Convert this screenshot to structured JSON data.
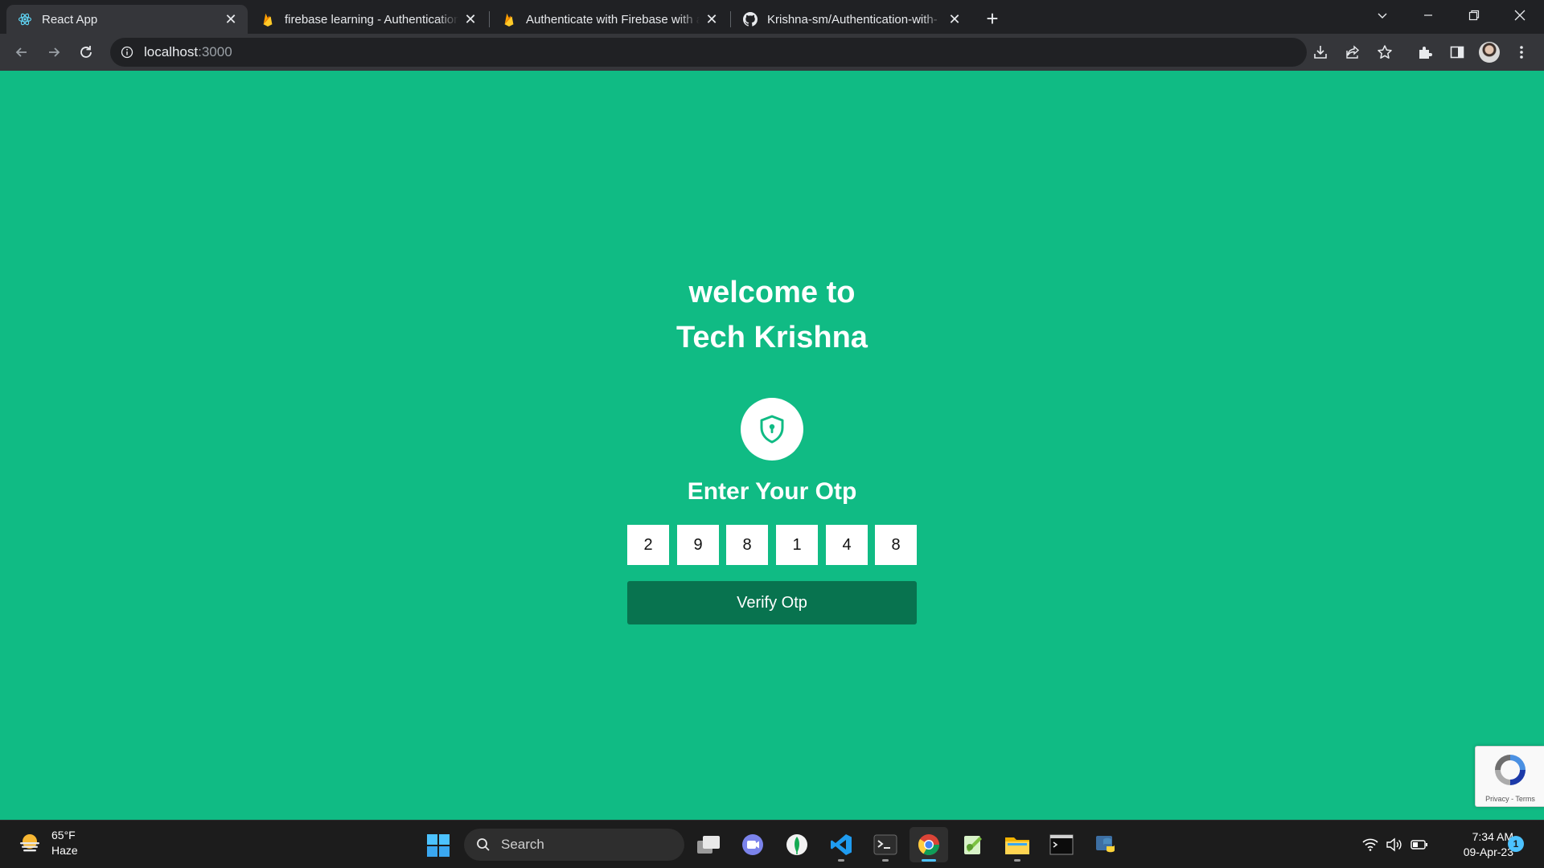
{
  "browser": {
    "tabs": [
      {
        "label": "React App",
        "favicon": "react-icon",
        "active": true
      },
      {
        "label": "firebase learning - Authentication",
        "favicon": "firebase-icon",
        "active": false
      },
      {
        "label": "Authenticate with Firebase with a",
        "favicon": "firebase-icon",
        "active": false
      },
      {
        "label": "Krishna-sm/Authentication-with-",
        "favicon": "github-icon",
        "active": false
      }
    ],
    "new_tab_label": "+",
    "address": {
      "host": "localhost",
      "port": ":3000"
    }
  },
  "page": {
    "welcome_line1": "welcome to",
    "welcome_line2": "Tech Krishna",
    "badge_icon": "shield-keyhole-icon",
    "otp_heading": "Enter Your Otp",
    "otp_digits": [
      "2",
      "9",
      "8",
      "1",
      "4",
      "8"
    ],
    "verify_label": "Verify Otp",
    "recaptcha": {
      "privacy": "Privacy",
      "separator": " - ",
      "terms": "Terms"
    }
  },
  "taskbar": {
    "weather": {
      "temp": "65°F",
      "condition": "Haze"
    },
    "search_placeholder": "Search",
    "clock": {
      "time": "7:34 AM",
      "date": "09-Apr-23"
    },
    "notification_count": "1"
  },
  "colors": {
    "page_background": "#10bb84",
    "verify_button": "#08734f",
    "taskbar_accent": "#4cc2ff"
  }
}
